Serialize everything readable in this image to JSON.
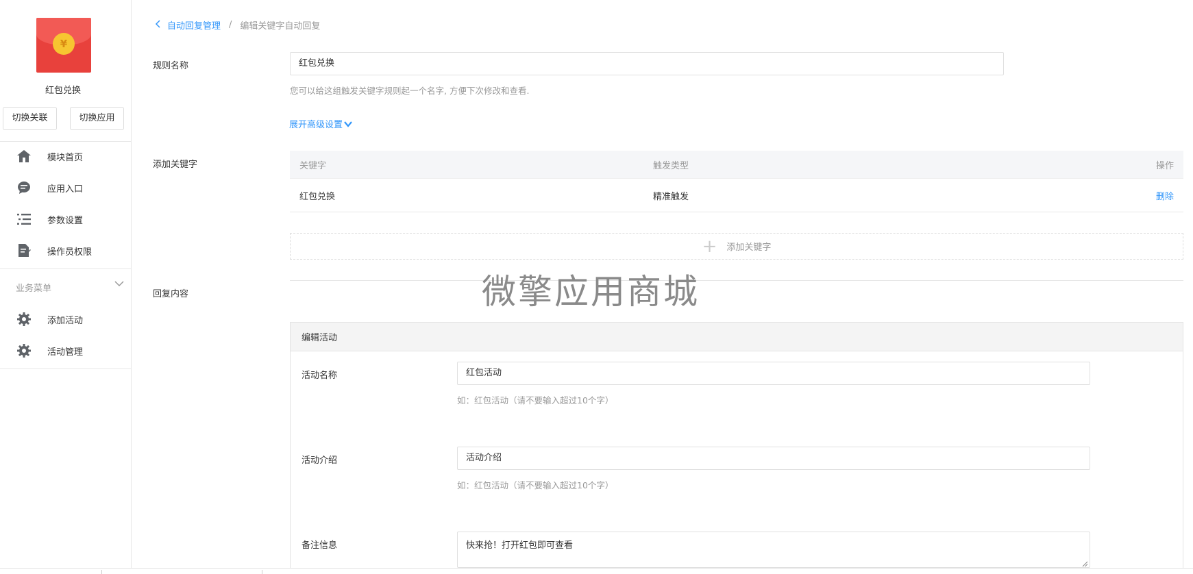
{
  "sidebar": {
    "app_name": "红包兑换",
    "switch_link_label": "切换关联",
    "switch_app_label": "切换应用",
    "nav_items": [
      {
        "label": "模块首页",
        "icon": "home-icon"
      },
      {
        "label": "应用入口",
        "icon": "chat-bubble-icon"
      },
      {
        "label": "参数设置",
        "icon": "list-icon"
      },
      {
        "label": "操作员权限",
        "icon": "document-edit-icon"
      }
    ],
    "group_title": "业务菜单",
    "group_items": [
      {
        "label": "添加活动",
        "icon": "gear-icon"
      },
      {
        "label": "活动管理",
        "icon": "gear-icon"
      }
    ]
  },
  "breadcrumb": {
    "parent": "自动回复管理",
    "separator": "/",
    "current": "编辑关键字自动回复"
  },
  "form": {
    "rule_name_label": "规则名称",
    "rule_name_value": "红包兑换",
    "rule_name_help": "您可以给这组触发关键字规则起一个名字, 方便下次修改和查看.",
    "expand_advanced": "展开高级设置",
    "add_keyword_label": "添加关键字",
    "keyword_table": {
      "headers": [
        "关键字",
        "触发类型",
        "操作"
      ],
      "rows": [
        {
          "keyword": "红包兑换",
          "trigger_type": "精准触发",
          "action": "删除"
        }
      ]
    },
    "add_keyword_button": "添加关键字",
    "reply_content_label": "回复内容"
  },
  "watermark": "微擎应用商城",
  "edit_panel": {
    "title": "编辑活动",
    "activity_name_label": "活动名称",
    "activity_name_value": "红包活动",
    "activity_name_help": "如：红包活动（请不要输入超过10个字）",
    "activity_intro_label": "活动介绍",
    "activity_intro_value": "活动介绍",
    "activity_intro_help": "如：红包活动（请不要输入超过10个字）",
    "remark_label": "备注信息",
    "remark_value": "快来抢！打开红包即可查看"
  },
  "colors": {
    "accent": "#3296fa",
    "logo_red": "#e8413c",
    "coin_yellow": "#f7c531"
  }
}
